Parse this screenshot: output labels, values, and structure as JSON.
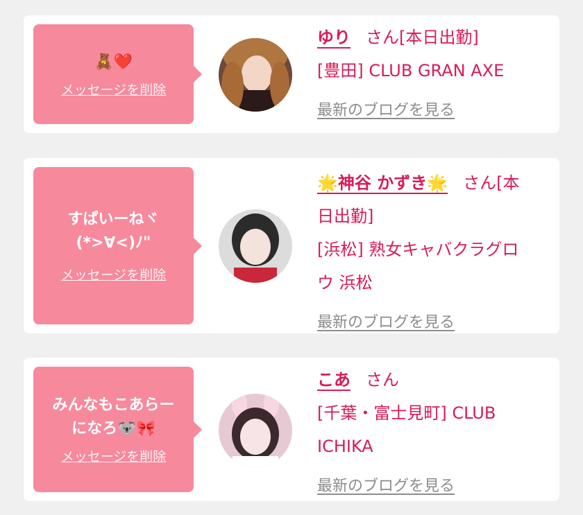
{
  "messages": [
    {
      "text_lines": [
        "🧸❤️"
      ],
      "delete_label": "メッセージを削除",
      "name": "ゆり",
      "suffix": "さん[本日出勤]",
      "shop": "[豊田] CLUB GRAN AXE",
      "blog_link": "最新のブログを見る"
    },
    {
      "text_lines": [
        "すぱいーねヾ",
        "(*>∀<)ﾉ\""
      ],
      "delete_label": "メッセージを削除",
      "name": "🌟神谷 かずき🌟",
      "suffix_lines": [
        "さん[本",
        "日出勤]"
      ],
      "shop_lines": [
        "[浜松] 熟女キャバクラグロ",
        "ウ 浜松"
      ],
      "blog_link": "最新のブログを見る"
    },
    {
      "text_lines": [
        "みんなもこあらー",
        "になろ🐨🎀"
      ],
      "delete_label": "メッセージを削除",
      "name": "こあ",
      "suffix": "さん",
      "shop_lines": [
        "[千葉・富士見町] CLUB",
        "ICHIKA"
      ],
      "blog_link": "最新のブログを見る"
    }
  ],
  "colors": {
    "page_bg": "#f0f0f0",
    "bubble": "#f7899c",
    "accent": "#d81b55",
    "link_gray": "#8c8c8c"
  }
}
